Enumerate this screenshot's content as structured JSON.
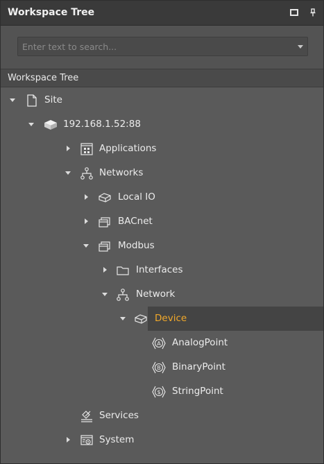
{
  "panel": {
    "title": "Workspace Tree",
    "maximize_icon": "maximize-icon",
    "pin_icon": "pin-icon"
  },
  "search": {
    "placeholder": "Enter text to search..."
  },
  "tree_header": "Workspace Tree",
  "tree": {
    "site": "Site",
    "device_ip": "192.168.1.52:88",
    "applications": "Applications",
    "networks": "Networks",
    "local_io": "Local IO",
    "bacnet": "BACnet",
    "modbus": "Modbus",
    "interfaces": "Interfaces",
    "network": "Network",
    "device": "Device",
    "analog_point": "AnalogPoint",
    "binary_point": "BinaryPoint",
    "string_point": "StringPoint",
    "services": "Services",
    "system": "System"
  },
  "colors": {
    "selected_text": "#f2a92a",
    "panel_bg": "#5a5a5a",
    "titlebar_bg": "#3a3a3a"
  }
}
